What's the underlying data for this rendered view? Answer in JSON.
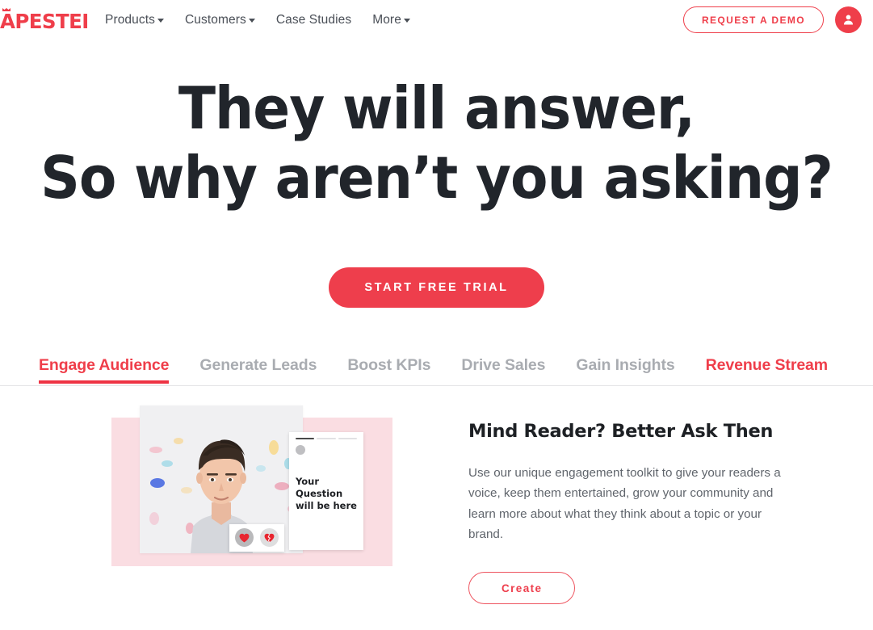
{
  "brand": {
    "logo_text": "APESTER",
    "accent_color": "#ef3e4a",
    "cta_color": "#ee3e4c"
  },
  "header": {
    "nav": [
      {
        "label": "Products",
        "has_dropdown": true
      },
      {
        "label": "Customers",
        "has_dropdown": true
      },
      {
        "label": "Case Studies",
        "has_dropdown": false
      },
      {
        "label": "More",
        "has_dropdown": true
      }
    ],
    "demo_button": "REQUEST A DEMO",
    "account_icon": "user-avatar-icon"
  },
  "hero": {
    "line1": "They will answer,",
    "line2": "So why aren’t you asking?",
    "cta": "START FREE TRIAL"
  },
  "tabs": [
    {
      "label": "Engage Audience",
      "state": "active"
    },
    {
      "label": "Generate Leads",
      "state": "inactive"
    },
    {
      "label": "Boost KPIs",
      "state": "inactive"
    },
    {
      "label": "Drive Sales",
      "state": "inactive"
    },
    {
      "label": "Gain Insights",
      "state": "inactive"
    },
    {
      "label": "Revenue Stream",
      "state": "accent"
    }
  ],
  "feature": {
    "title": "Mind Reader? Better Ask Then",
    "body": "Use our unique engagement toolkit to give your readers a voice, keep them entertained, grow your community and learn more about what they think about a topic or your brand.",
    "button": "Create",
    "visual": {
      "question_card_text": "Your Question will be here",
      "reactions": [
        {
          "icon": "heart-icon",
          "glyph": "❤"
        },
        {
          "icon": "broken-heart-icon",
          "glyph": "💔"
        }
      ],
      "photo_alt": "young-man-with-confetti-photo"
    }
  }
}
